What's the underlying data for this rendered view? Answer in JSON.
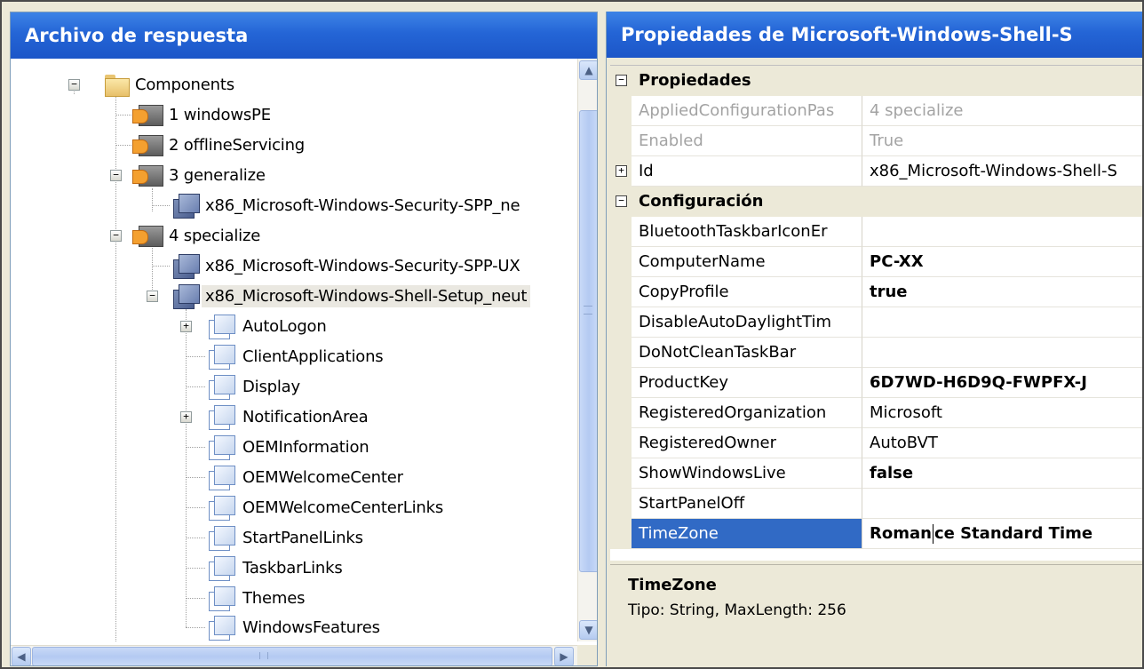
{
  "left_pane": {
    "title": "Archivo de respuesta",
    "tree": [
      {
        "label": "Components",
        "icon": "folder-icon"
      },
      {
        "label": "1 windowsPE",
        "icon": "configuration-pass-icon"
      },
      {
        "label": "2 offlineServicing",
        "icon": "configuration-pass-icon"
      },
      {
        "label": "3 generalize",
        "icon": "configuration-pass-icon"
      },
      {
        "label": "x86_Microsoft-Windows-Security-SPP_ne",
        "icon": "component-icon"
      },
      {
        "label": "4 specialize",
        "icon": "configuration-pass-icon"
      },
      {
        "label": "x86_Microsoft-Windows-Security-SPP-UX",
        "icon": "component-icon"
      },
      {
        "label": "x86_Microsoft-Windows-Shell-Setup_neut",
        "icon": "component-icon"
      },
      {
        "label": "AutoLogon",
        "icon": "setting-icon"
      },
      {
        "label": "ClientApplications",
        "icon": "setting-icon"
      },
      {
        "label": "Display",
        "icon": "setting-icon"
      },
      {
        "label": "NotificationArea",
        "icon": "setting-icon"
      },
      {
        "label": "OEMInformation",
        "icon": "setting-icon"
      },
      {
        "label": "OEMWelcomeCenter",
        "icon": "setting-icon"
      },
      {
        "label": "OEMWelcomeCenterLinks",
        "icon": "setting-icon"
      },
      {
        "label": "StartPanelLinks",
        "icon": "setting-icon"
      },
      {
        "label": "TaskbarLinks",
        "icon": "setting-icon"
      },
      {
        "label": "Themes",
        "icon": "setting-icon"
      },
      {
        "label": "WindowsFeatures",
        "icon": "setting-icon"
      }
    ],
    "expander_collapse": "−",
    "expander_expand": "+",
    "scroll_up": "▲",
    "scroll_down": "▼",
    "scroll_left": "◀",
    "scroll_right": "▶"
  },
  "right_pane": {
    "title": "Propiedades de Microsoft-Windows-Shell-S",
    "categories": {
      "properties": "Propiedades",
      "settings": "Configuración"
    },
    "properties_rows": [
      {
        "name": "AppliedConfigurationPas",
        "value": "4 specialize"
      },
      {
        "name": "Enabled",
        "value": "True"
      },
      {
        "name": "Id",
        "value": "x86_Microsoft-Windows-Shell-S"
      }
    ],
    "settings_rows": [
      {
        "name": "BluetoothTaskbarIconEr",
        "value": ""
      },
      {
        "name": "ComputerName",
        "value": "PC-XX"
      },
      {
        "name": "CopyProfile",
        "value": "true"
      },
      {
        "name": "DisableAutoDaylightTim",
        "value": ""
      },
      {
        "name": "DoNotCleanTaskBar",
        "value": ""
      },
      {
        "name": "ProductKey",
        "value": "6D7WD-H6D9Q-FWPFX-J"
      },
      {
        "name": "RegisteredOrganization",
        "value": "Microsoft"
      },
      {
        "name": "RegisteredOwner",
        "value": "AutoBVT"
      },
      {
        "name": "ShowWindowsLive",
        "value": "false"
      },
      {
        "name": "StartPanelOff",
        "value": ""
      },
      {
        "name": "TimeZone",
        "value_before_caret": "Roman",
        "value_after_caret": "ce Standard Time"
      }
    ],
    "description": {
      "title": "TimeZone",
      "text": "Tipo: String, MaxLength: 256"
    }
  },
  "colors": {
    "header_blue": "#2465d6",
    "selection_blue": "#316ac5",
    "panel_beige": "#ece9d8"
  }
}
